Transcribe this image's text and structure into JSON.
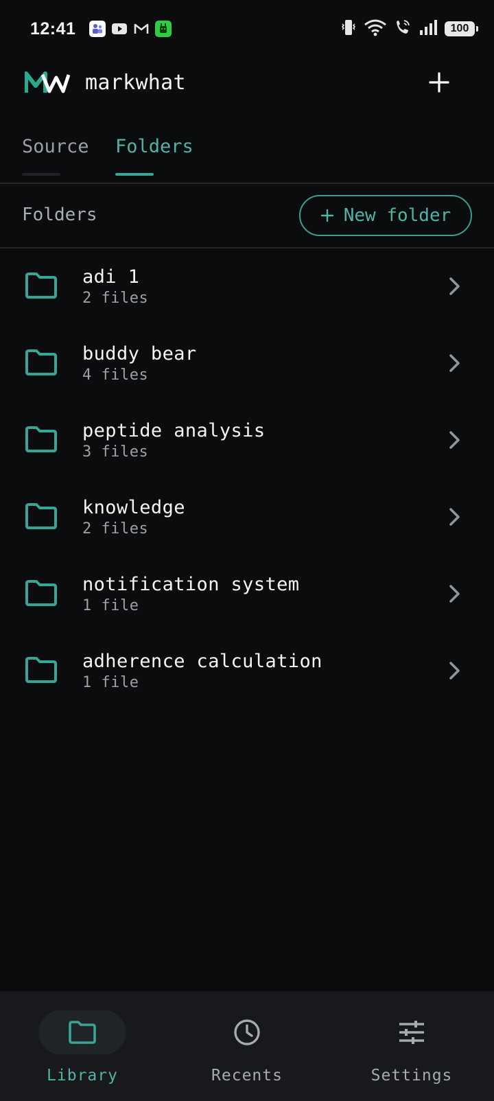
{
  "status_bar": {
    "time": "12:41",
    "battery": "100",
    "notification_icons": [
      "teams-icon",
      "youtube-icon",
      "gmail-icon",
      "android-app-icon"
    ],
    "system_icons": [
      "vibrate-icon",
      "wifi-icon",
      "wifi-calling-icon",
      "signal-icon",
      "battery-icon"
    ]
  },
  "header": {
    "app_name": "markwhat",
    "logo_colors": {
      "primary": "#2aa892",
      "secondary": "#ffffff"
    }
  },
  "tabs": [
    {
      "label": "Source",
      "active": false
    },
    {
      "label": "Folders",
      "active": true
    }
  ],
  "section": {
    "title": "Folders",
    "new_folder_label": "New folder",
    "new_folder_icon": "plus-icon"
  },
  "folders": [
    {
      "name": "adi 1",
      "count": "2 files"
    },
    {
      "name": "buddy bear",
      "count": "4 files"
    },
    {
      "name": "peptide analysis",
      "count": "3 files"
    },
    {
      "name": "knowledge",
      "count": "2 files"
    },
    {
      "name": "notification system",
      "count": "1 file"
    },
    {
      "name": "adherence calculation",
      "count": "1 file"
    }
  ],
  "bottom_nav": [
    {
      "label": "Library",
      "icon": "folder-icon",
      "active": true
    },
    {
      "label": "Recents",
      "icon": "clock-icon",
      "active": false
    },
    {
      "label": "Settings",
      "icon": "sliders-icon",
      "active": false
    }
  ],
  "colors": {
    "accent": "#4fb3a6",
    "background": "#0b0c0e",
    "nav_background": "#17191c"
  }
}
